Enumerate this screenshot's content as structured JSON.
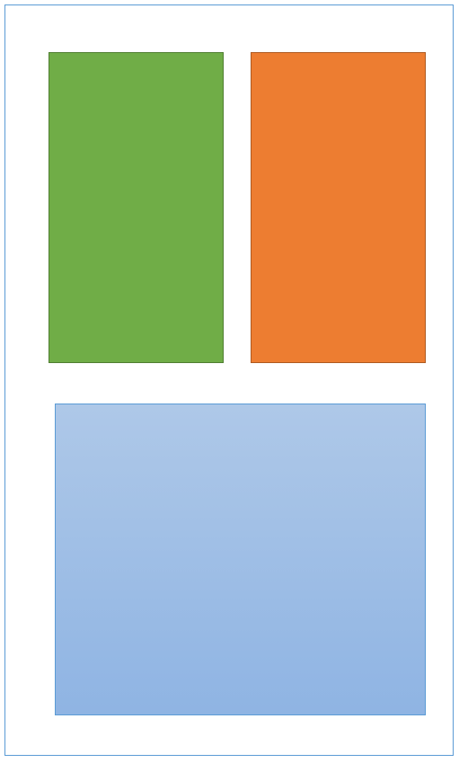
{
  "diagram": {
    "frame": {
      "border_color": "#5b9bd5"
    },
    "shapes": [
      {
        "id": "green",
        "fill": "#70ad47",
        "border_color": "#507e32"
      },
      {
        "id": "orange",
        "fill": "#ed7d31",
        "border_color": "#ae5a21"
      },
      {
        "id": "blue",
        "fill_top": "#aec8e8",
        "fill_bottom": "#8fb4e3",
        "border_color": "#5b9bd5"
      }
    ]
  }
}
